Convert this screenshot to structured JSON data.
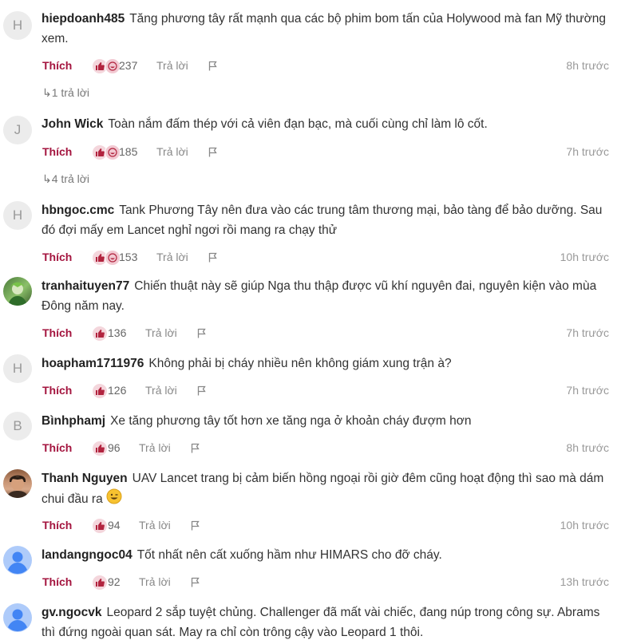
{
  "ui": {
    "like_label": "Thích",
    "reply_label": "Trả lời"
  },
  "comments": [
    {
      "avatar_letter": "H",
      "username": "hiepdoanh485",
      "text": "Tăng phương tây rất mạnh qua các bộ phim bom tấn của Holywood mà fan Mỹ thường xem.",
      "likes": "237",
      "time": "8h trước",
      "replies": "1 trả lời"
    },
    {
      "avatar_letter": "J",
      "username": "John Wick",
      "text": "Toàn nắm đấm thép với cả viên đạn bạc, mà cuối cùng chỉ làm lô cốt.",
      "likes": "185",
      "time": "7h trước",
      "replies": "4 trả lời"
    },
    {
      "avatar_letter": "H",
      "username": "hbngoc.cmc",
      "text": "Tank Phương Tây nên đưa vào các trung tâm thương mại, bảo tàng để bảo dưỡng. Sau đó đợi mấy em Lancet nghỉ ngơi rồi mang ra chạy thử",
      "likes": "153",
      "time": "10h trước"
    },
    {
      "avatar_letter": "",
      "username": "tranhaituyen77",
      "text": "Chiến thuật này sẽ giúp Nga thu thập được vũ khí nguyên đai, nguyên kiện vào mùa Đông năm nay.",
      "likes": "136",
      "time": "7h trước"
    },
    {
      "avatar_letter": "H",
      "username": "hoapham1711976",
      "text": "Không phải bị cháy nhiều nên không giám xung trận à?",
      "likes": "126",
      "time": "7h trước"
    },
    {
      "avatar_letter": "B",
      "username": "Bìnhphamj",
      "text": "Xe tăng phương tây tốt hơn xe tăng nga ở khoản cháy đượm hơn",
      "likes": "96",
      "time": "8h trước"
    },
    {
      "avatar_letter": "",
      "username": "Thanh Nguyen",
      "text": "UAV Lancet trang bị cảm biến hồng ngoại rồi giờ đêm cũng hoạt động thì sao mà dám chui đầu ra",
      "likes": "94",
      "time": "10h trước"
    },
    {
      "avatar_letter": "",
      "username": "landangngoc04",
      "text": "Tốt nhất nên cất xuống hầm như HIMARS cho đỡ cháy.",
      "likes": "92",
      "time": "13h trước"
    },
    {
      "avatar_letter": "",
      "username": "gv.ngocvk",
      "text": "Leopard 2 sắp tuyệt chủng. Challenger đã mất vài chiếc, đang núp trong công sự. Abrams thì đứng ngoài quan sát. May ra chỉ còn trông cậy vào Leopard 1 thôi."
    }
  ]
}
